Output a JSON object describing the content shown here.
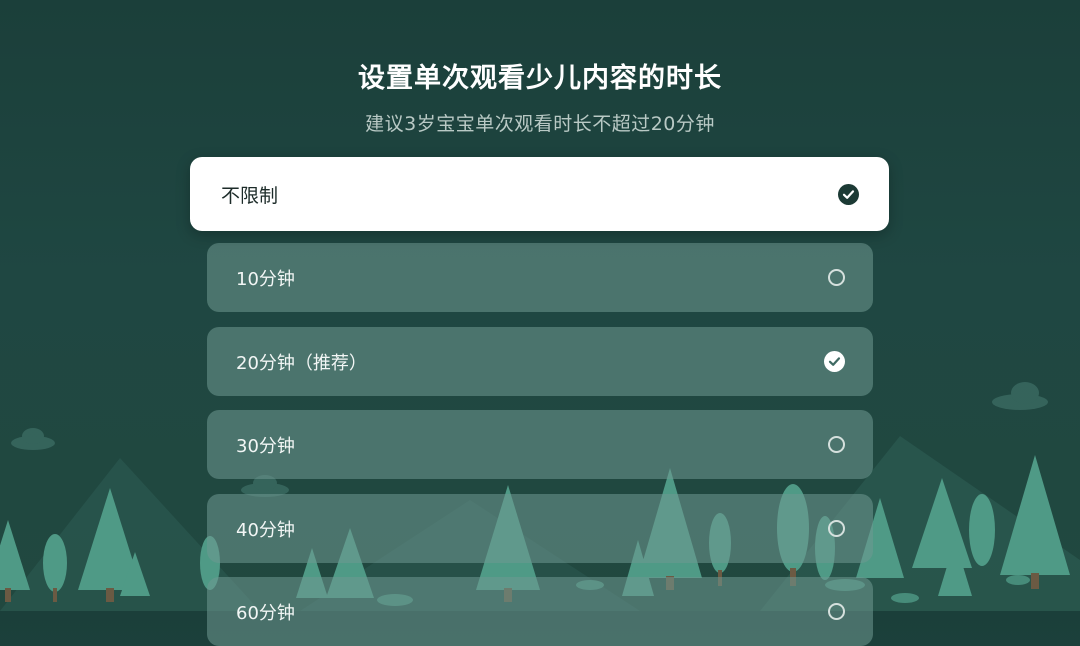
{
  "header": {
    "title": "设置单次观看少儿内容的时长",
    "subtitle": "建议3岁宝宝单次观看时长不超过20分钟"
  },
  "options": [
    {
      "label": "不限制",
      "state": "checked",
      "focused": true
    },
    {
      "label": "10分钟",
      "state": "unchecked"
    },
    {
      "label": "20分钟（推荐）",
      "state": "checked"
    },
    {
      "label": "30分钟",
      "state": "unchecked"
    },
    {
      "label": "40分钟",
      "state": "unchecked"
    },
    {
      "label": "60分钟",
      "state": "unchecked"
    }
  ],
  "colors": {
    "background": "#1f4742",
    "focused_card": "#ffffff",
    "card": "#6f9992",
    "tree": "#4f9a86",
    "mountain": "#2a5a50"
  }
}
